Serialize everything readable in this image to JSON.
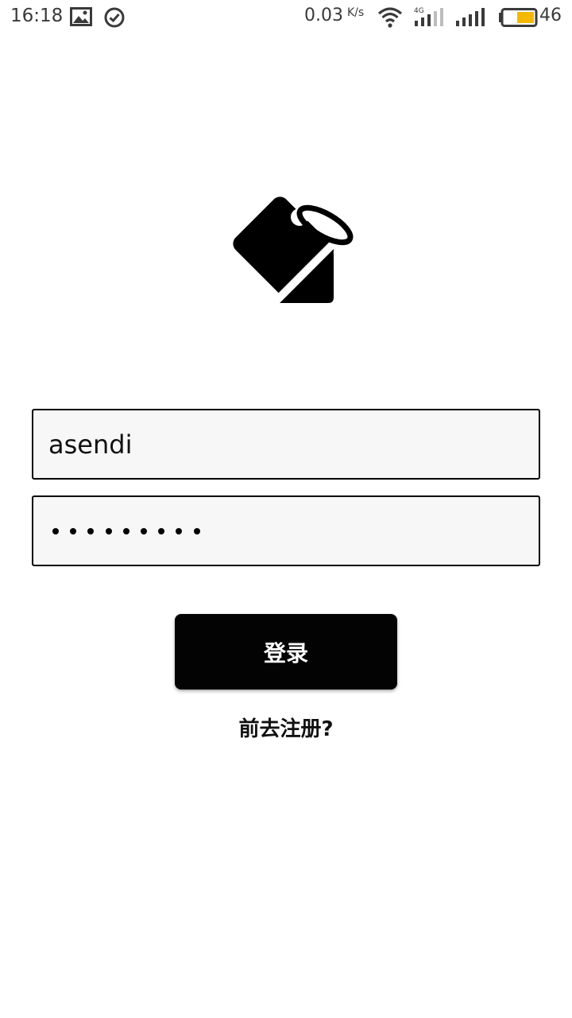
{
  "status_bar": {
    "time": "16:18",
    "net_speed": "0.03",
    "net_speed_unit": "K/s",
    "network_type": "4G",
    "battery_level": "46",
    "icons": [
      "image-icon",
      "check-circle-icon",
      "wifi-icon",
      "cell-signal-4g-icon",
      "cell-signal-icon",
      "battery-icon"
    ],
    "battery_color": "#f5b800"
  },
  "logo": {
    "icon": "tag-icon"
  },
  "login_form": {
    "username_value": "asendi",
    "password_mask_length": 9,
    "login_label": "登录",
    "register_link_label": "前去注册?"
  },
  "colors": {
    "button_bg": "#030303",
    "field_bg": "#f7f7f7"
  }
}
